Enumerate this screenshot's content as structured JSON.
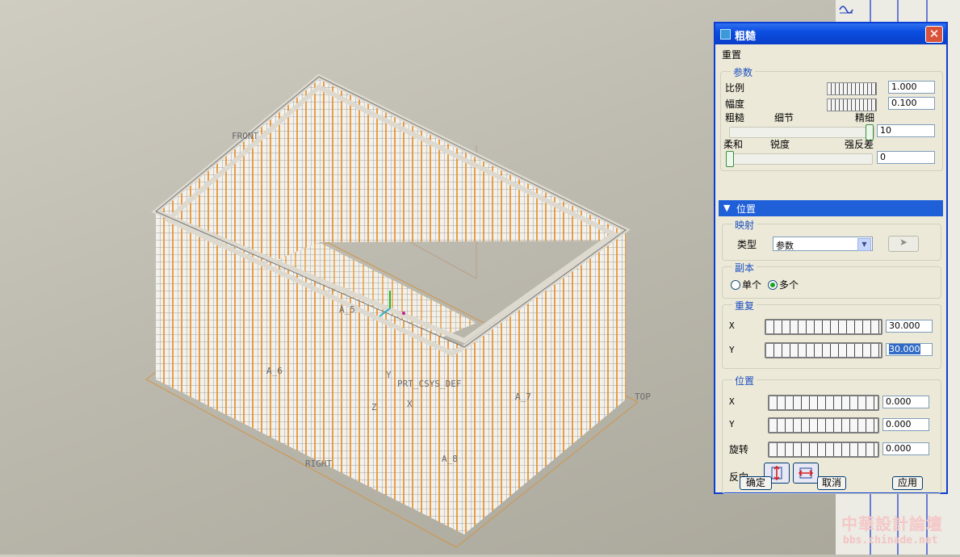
{
  "viewport": {
    "datum_labels": [
      "FRONT",
      "TOP",
      "RIGHT",
      "A_5",
      "A_6",
      "A_7",
      "A_8",
      "PRT_CSYS_DEF",
      "Y",
      "Z",
      "X"
    ]
  },
  "dialog": {
    "title": "粗糙",
    "menu_reset": "重置",
    "params": {
      "legend": "参数",
      "scale_label": "比例",
      "scale_value": "1.000",
      "amplitude_label": "幅度",
      "amplitude_value": "0.100",
      "rough_label": "粗糙",
      "detail_label": "细节",
      "fine_label": "精细",
      "detail_value": "10",
      "soft_label": "柔和",
      "sharp_label": "锐度",
      "contrast_label": "强反差",
      "sharp_value": "0"
    },
    "position_section": {
      "header": "位置",
      "mapping": {
        "legend": "映射",
        "type_label": "类型",
        "type_value": "参数"
      },
      "copies": {
        "legend": "副本",
        "single": "单个",
        "multiple": "多个",
        "selected": "multiple"
      },
      "repeat": {
        "legend": "重复",
        "x_label": "X",
        "x_value": "30.000",
        "y_label": "Y",
        "y_value": "30.000"
      },
      "placement": {
        "legend": "位置",
        "x_label": "X",
        "x_value": "0.000",
        "y_label": "Y",
        "y_value": "0.000",
        "rotate_label": "旋转",
        "rotate_value": "0.000",
        "flip_label": "反向"
      }
    },
    "buttons": {
      "ok": "确定",
      "cancel": "取消",
      "apply": "应用"
    }
  },
  "watermark": {
    "logo_text": "中華設計論壇",
    "url": "bbs.chinade.net"
  },
  "colors": {
    "title_bar": "#0b4ee0",
    "section_header": "#1f5fd8",
    "model_orange": "#e58a1f",
    "close_red": "#d9523a"
  }
}
